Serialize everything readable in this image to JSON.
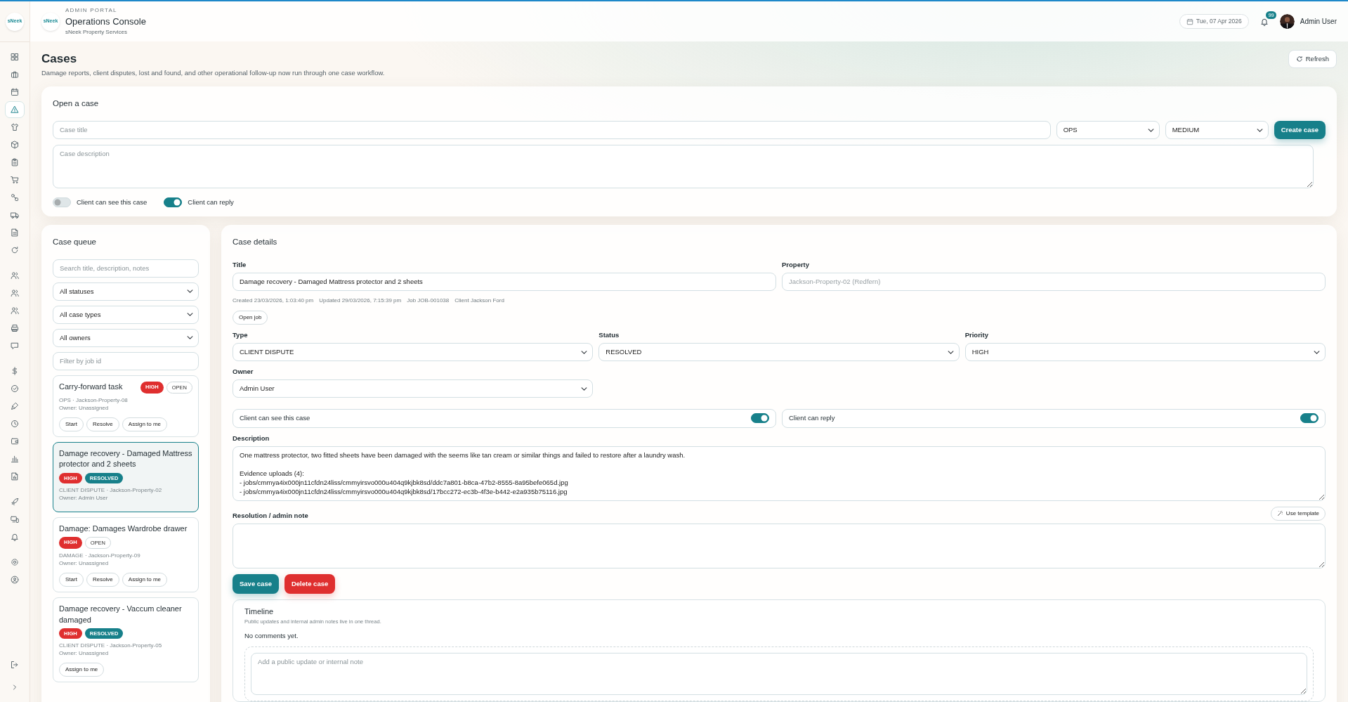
{
  "sidebar": {
    "logo_text": "sNeek",
    "groups": [
      {
        "items": [
          {
            "selected": false
          },
          {
            "selected": false
          },
          {
            "selected": false
          },
          {
            "selected": true
          },
          {
            "selected": false
          },
          {
            "selected": false
          },
          {
            "selected": false
          },
          {
            "selected": false
          },
          {
            "selected": false
          },
          {
            "selected": false
          },
          {
            "selected": false
          },
          {
            "selected": false
          }
        ]
      },
      {
        "items": [
          {
            "selected": false
          },
          {
            "selected": false
          },
          {
            "selected": false
          },
          {
            "selected": false
          },
          {
            "selected": false
          }
        ]
      },
      {
        "items": [
          {
            "selected": false
          },
          {
            "selected": false
          },
          {
            "selected": false
          },
          {
            "selected": false
          },
          {
            "selected": false
          },
          {
            "selected": false
          },
          {
            "selected": false
          }
        ]
      },
      {
        "items": [
          {
            "selected": false
          },
          {
            "selected": false
          },
          {
            "selected": false
          }
        ]
      },
      {
        "items": [
          {
            "selected": false
          },
          {
            "selected": false
          }
        ]
      }
    ]
  },
  "header": {
    "eyebrow": "ADMIN PORTAL",
    "logo_text": "sNeek",
    "title": "Operations Console",
    "subtitle": "sNeek Property Services",
    "date": "Tue, 07 Apr 2026",
    "notification_count": "99",
    "user_name": "Admin User"
  },
  "page": {
    "title": "Cases",
    "subtitle": "Damage reports, client disputes, lost and found, and other operational follow-up now run through one case workflow.",
    "refresh_button": "Refresh"
  },
  "open_case": {
    "heading": "Open a case",
    "title_placeholder": "Case title",
    "type_value": "OPS",
    "priority_value": "MEDIUM",
    "create_button": "Create case",
    "description_placeholder": "Case description",
    "toggles": [
      {
        "label": "Client can see this case",
        "on": false
      },
      {
        "label": "Client can reply",
        "on": true
      }
    ]
  },
  "queue": {
    "heading": "Case queue",
    "search_placeholder": "Search title, description, notes",
    "filters": [
      "All statuses",
      "All case types",
      "All owners"
    ],
    "job_filter_placeholder": "Filter by job id",
    "cases": [
      {
        "title": "Carry-forward task",
        "badges": [
          {
            "text": "HIGH",
            "kind": "priority"
          },
          {
            "text": "OPEN",
            "kind": "open"
          }
        ],
        "meta": "OPS · Jackson-Property-08",
        "owner": "Owner: Unassigned",
        "actions": [
          "Start",
          "Resolve",
          "Assign to me"
        ],
        "selected": false
      },
      {
        "title": "Damage recovery - Damaged Mattress protector and 2 sheets",
        "badges": [
          {
            "text": "HIGH",
            "kind": "priority"
          },
          {
            "text": "RESOLVED",
            "kind": "resolved"
          }
        ],
        "meta": "CLIENT DISPUTE · Jackson-Property-02",
        "owner": "Owner: Admin User",
        "selected": true
      },
      {
        "title": "Damage: Damages Wardrobe drawer",
        "badges": [
          {
            "text": "HIGH",
            "kind": "priority"
          },
          {
            "text": "OPEN",
            "kind": "open"
          }
        ],
        "meta": "DAMAGE · Jackson-Property-09",
        "owner": "Owner: Unassigned",
        "actions": [
          "Start",
          "Resolve",
          "Assign to me"
        ],
        "selected": false
      },
      {
        "title": "Damage recovery - Vaccum cleaner damaged",
        "badges": [
          {
            "text": "HIGH",
            "kind": "priority"
          },
          {
            "text": "RESOLVED",
            "kind": "resolved"
          }
        ],
        "meta": "CLIENT DISPUTE · Jackson-Property-05",
        "owner": "Owner: Unassigned",
        "actions": [
          "Assign to me"
        ],
        "selected": false
      }
    ]
  },
  "details": {
    "heading": "Case details",
    "title_label": "Title",
    "title_value": "Damage recovery - Damaged Mattress protector and 2 sheets",
    "property_label": "Property",
    "property_value": "Jackson-Property-02 (Redfern)",
    "meta": [
      "Created 23/03/2026, 1:03:40 pm",
      "Updated 29/03/2026, 7:15:39 pm",
      "Job JOB-001038",
      "Client Jackson Ford"
    ],
    "open_job_button": "Open job",
    "selects": [
      {
        "label": "Type",
        "value": "CLIENT DISPUTE"
      },
      {
        "label": "Status",
        "value": "RESOLVED"
      },
      {
        "label": "Priority",
        "value": "HIGH"
      },
      {
        "label": "Owner",
        "value": "Admin User"
      }
    ],
    "toggles": [
      {
        "label": "Client can see this case",
        "on": true
      },
      {
        "label": "Client can reply",
        "on": true
      }
    ],
    "description_label": "Description",
    "description": "One mattress protector, two fitted sheets have been damaged with the seems like tan cream or similar things and failed to restore after a laundry wash.\n\nEvidence uploads (4):\n- jobs/cmmya4ix000jn11cfdn24liss/cmmyirsvo000u404q9kjbk8sd/ddc7a801-b8ca-47b2-8555-8a95befe065d.jpg\n- jobs/cmmya4ix000jn11cfdn24liss/cmmyirsvo000u404q9kjbk8sd/17bcc272-ec3b-4f3e-b442-e2a935b75116.jpg",
    "resolution_label": "Resolution / admin note",
    "use_template_button": "Use template",
    "save_button": "Save case",
    "delete_button": "Delete case",
    "timeline": {
      "title": "Timeline",
      "subtitle": "Public updates and internal admin notes live in one thread.",
      "empty_text": "No comments yet.",
      "comment_placeholder": "Add a public update or internal note"
    }
  }
}
